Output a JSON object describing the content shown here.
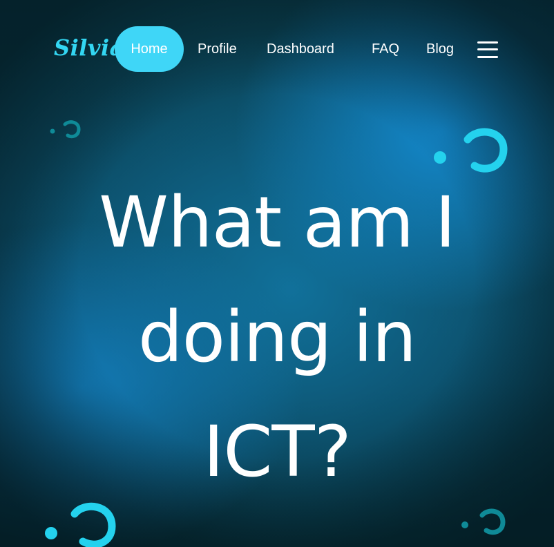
{
  "nav": {
    "logo": "Silvia",
    "items": [
      {
        "label": "Home",
        "active": true
      },
      {
        "label": "Profile",
        "active": false
      },
      {
        "label": "Dashboard",
        "active": false
      },
      {
        "label": "FAQ",
        "active": false
      },
      {
        "label": "Blog",
        "active": false
      }
    ],
    "menu_icon": "hamburger-menu-icon"
  },
  "hero": {
    "headline_lines": [
      "What am I",
      "doing in",
      "ICT?"
    ]
  },
  "decorations": {
    "icon": "question-mark-icon",
    "colors": {
      "bright": "#24d2ee",
      "faded": "#0f8a97"
    }
  },
  "colors": {
    "accent": "#3fd6f7",
    "logo": "#33d6f2",
    "text": "#ffffff"
  }
}
